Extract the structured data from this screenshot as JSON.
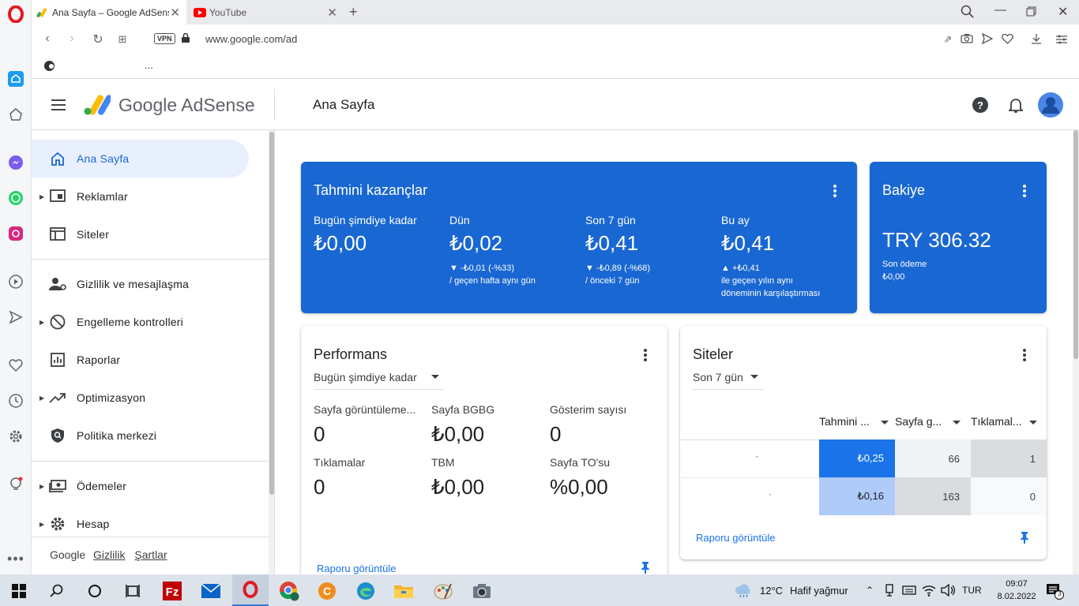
{
  "browser": {
    "tabs": [
      {
        "label": "Ana Sayfa – Google AdSens"
      },
      {
        "label": "YouTube"
      }
    ],
    "address": "www.google.com/ad",
    "vpn_label": "VPN",
    "bookmark_more": "..."
  },
  "header": {
    "product_google": "Google",
    "product_name": "AdSense",
    "page_title": "Ana Sayfa"
  },
  "sidebar": {
    "items": [
      {
        "label": "Ana Sayfa"
      },
      {
        "label": "Reklamlar"
      },
      {
        "label": "Siteler"
      },
      {
        "label": "Gizlilik ve mesajlaşma"
      },
      {
        "label": "Engelleme kontrolleri"
      },
      {
        "label": "Raporlar"
      },
      {
        "label": "Optimizasyon"
      },
      {
        "label": "Politika merkezi"
      },
      {
        "label": "Ödemeler"
      },
      {
        "label": "Hesap"
      }
    ],
    "footer": {
      "google": "Google",
      "privacy": "Gizlilik",
      "terms": "Şartlar"
    }
  },
  "earnings": {
    "title": "Tahmini kazançlar",
    "today_label": "Bugün şimdiye kadar",
    "today_value": "₺0,00",
    "yesterday_label": "Dün",
    "yesterday_value": "₺0,02",
    "yesterday_delta": "▼ -₺0,01 (-%33)",
    "yesterday_compare": "/ geçen hafta aynı gün",
    "last7_label": "Son 7 gün",
    "last7_value": "₺0,41",
    "last7_delta": "▼ -₺0,89 (-%68)",
    "last7_compare": "/ önceki 7 gün",
    "month_label": "Bu ay",
    "month_value": "₺0,41",
    "month_delta": "▲ +₺0,41",
    "month_compare_1": "ile geçen yılın aynı",
    "month_compare_2": "döneminin karşılaştırması"
  },
  "balance": {
    "title": "Bakiye",
    "amount": "TRY 306.32",
    "last_payment_label": "Son ödeme",
    "last_payment_value": "₺0,00"
  },
  "performance": {
    "title": "Performans",
    "range": "Bugün şimdiye kadar",
    "metrics": [
      {
        "label": "Sayfa görüntüleme...",
        "value": "0"
      },
      {
        "label": "Sayfa BGBG",
        "value": "₺0,00"
      },
      {
        "label": "Gösterim sayısı",
        "value": "0"
      },
      {
        "label": "Tıklamalar",
        "value": "0"
      },
      {
        "label": "TBM",
        "value": "₺0,00"
      },
      {
        "label": "Sayfa TO'su",
        "value": "%0,00"
      }
    ],
    "report_link": "Raporu görüntüle"
  },
  "sites": {
    "title": "Siteler",
    "range": "Son 7 gün",
    "columns": [
      "Tahmini ...",
      "Sayfa g...",
      "Tıklamal..."
    ],
    "rows": [
      {
        "name": "·",
        "earnings": "₺0,25",
        "pageviews": "66",
        "clicks": "1"
      },
      {
        "name": "·",
        "earnings": "₺0,16",
        "pageviews": "163",
        "clicks": "0"
      }
    ],
    "report_link": "Raporu görüntüle"
  },
  "taskbar": {
    "weather_temp": "12°C",
    "weather_desc": "Hafif yağmur",
    "lang": "TUR",
    "time": "09:07",
    "date": "8.02.2022",
    "notif_count": "3"
  },
  "colors": {
    "accent_blue": "#1967d2",
    "active_nav_bg": "#e8f0fe",
    "link": "#1a73e8"
  }
}
